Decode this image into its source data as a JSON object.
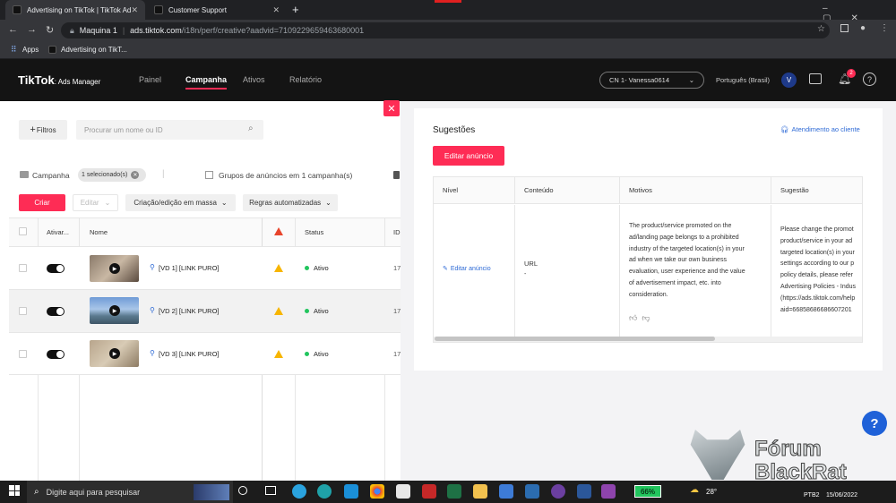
{
  "browser": {
    "tabs": [
      {
        "title": "Advertising on TikTok | TikTok Ad"
      },
      {
        "title": "Customer Support"
      }
    ],
    "new_tab": "+",
    "profile": "Maquina 1",
    "url_domain": "ads.tiktok.com",
    "url_path": "/i18n/perf/creative?aadvid=7109229659463680001",
    "bookmarks": [
      "Apps",
      "Advertising on TikT..."
    ]
  },
  "app": {
    "logo": "TikTok",
    "logo_sub": ": Ads Manager",
    "nav": [
      "Painel",
      "Campanha",
      "Ativos",
      "Relatório"
    ],
    "account": "CN 1- Vanessa0614",
    "language": "Português (Brasil)",
    "avatar": "V",
    "notif_count": "2"
  },
  "toolbar": {
    "filters": "Filtros",
    "search_placeholder": "Procurar um nome ou ID",
    "breadcrumb_campaign": "Campanha",
    "selected_badge": "1 selecionado(s)",
    "adgroups_label": "Grupos de anúncios em 1 campanha(s)",
    "create": "Criar",
    "edit": "Editar",
    "bulk": "Criação/edição em massa",
    "rules": "Regras automatizadas"
  },
  "table": {
    "headers": [
      "Ativar...",
      "Nome",
      "Status",
      "ID"
    ],
    "rows": [
      {
        "name": "[VD 1] [LINK PURO]",
        "status": "Ativo",
        "id": "17"
      },
      {
        "name": "[VD 2] [LINK PURO]",
        "status": "Ativo",
        "id": "17"
      },
      {
        "name": "[VD 3] [LINK PURO]",
        "status": "Ativo",
        "id": "17"
      }
    ]
  },
  "drawer": {
    "title": "Sugestões",
    "support": "Atendimento ao cliente",
    "edit_ad": "Editar anúncio",
    "headers": [
      "Nível",
      "Conteúdo",
      "Motivos",
      "Sugestão"
    ],
    "level_link": "Editar anúncio",
    "content": "URL",
    "content_sub": "-",
    "reason_lines": [
      "The product/service promoted on the",
      "ad/landing page belongs to a prohibited",
      "industry of the targeted location(s) in your",
      "ad when we take our own business",
      "evaluation, user experience and the value",
      "of advertisement impact, etc. into",
      "consideration."
    ],
    "suggestion_lines": [
      "Please change the promot",
      "product/service in your ad",
      "targeted location(s) in your",
      "settings according to our p",
      "policy details, please refer",
      "Advertising Policies - Indus",
      "(https://ads.tiktok.com/help",
      "aid=66858686686607201"
    ]
  },
  "taskbar": {
    "search": "Digite aqui para pesquisar",
    "battery": "66%",
    "temp": "28°",
    "lang": "PTB2",
    "date": "15/06/2022"
  },
  "watermark": {
    "line1": "Fórum",
    "line2": "BlackRat"
  },
  "colors": {
    "brand": "#fe2c55",
    "header": "#141414",
    "active_dot": "#22c55e",
    "warning": "#f7b500"
  }
}
